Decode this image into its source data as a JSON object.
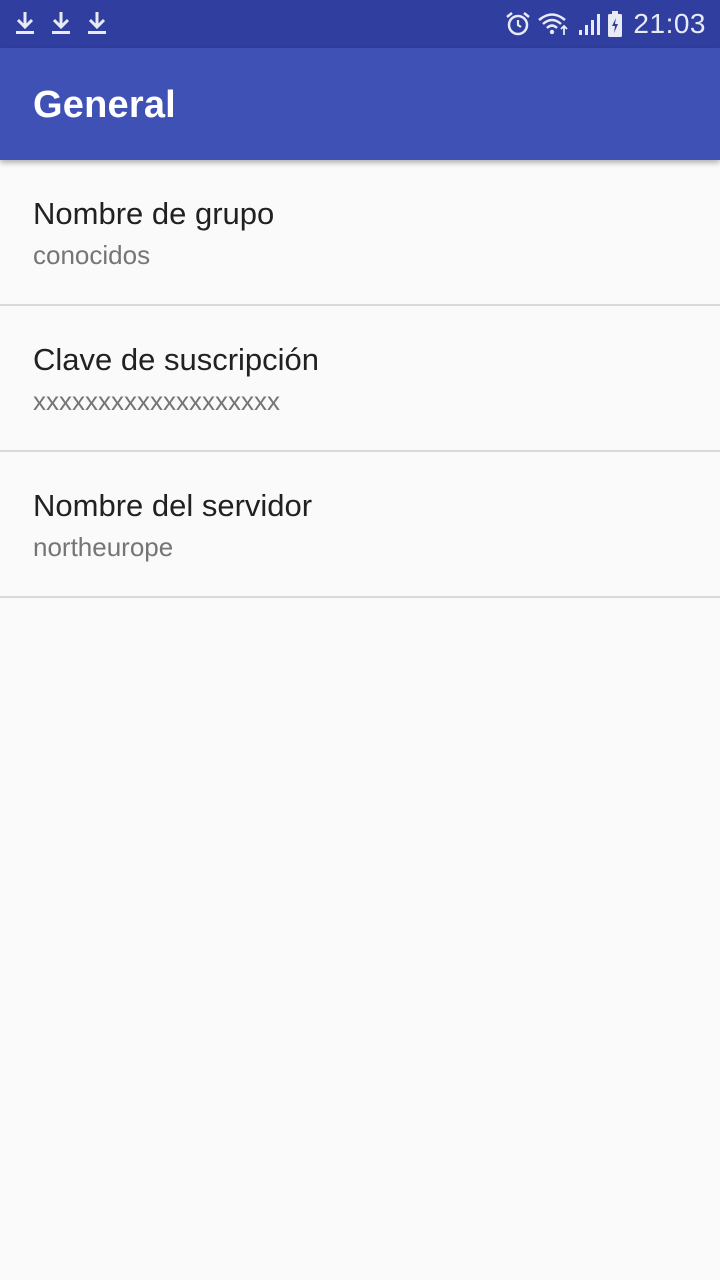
{
  "status_bar": {
    "time": "21:03",
    "left_icons": [
      "download-icon",
      "download-icon",
      "download-icon"
    ],
    "right_icons": [
      "alarm-icon",
      "wifi-icon",
      "signal-icon",
      "battery-charging-icon"
    ],
    "color": "#303f9f"
  },
  "app_bar": {
    "title": "General",
    "color": "#3f51b5"
  },
  "preferences": [
    {
      "title": "Nombre de grupo",
      "summary": "conocidos"
    },
    {
      "title": "Clave de suscripción",
      "summary": "xxxxxxxxxxxxxxxxxxx"
    },
    {
      "title": "Nombre del servidor",
      "summary": "northeurope"
    }
  ]
}
